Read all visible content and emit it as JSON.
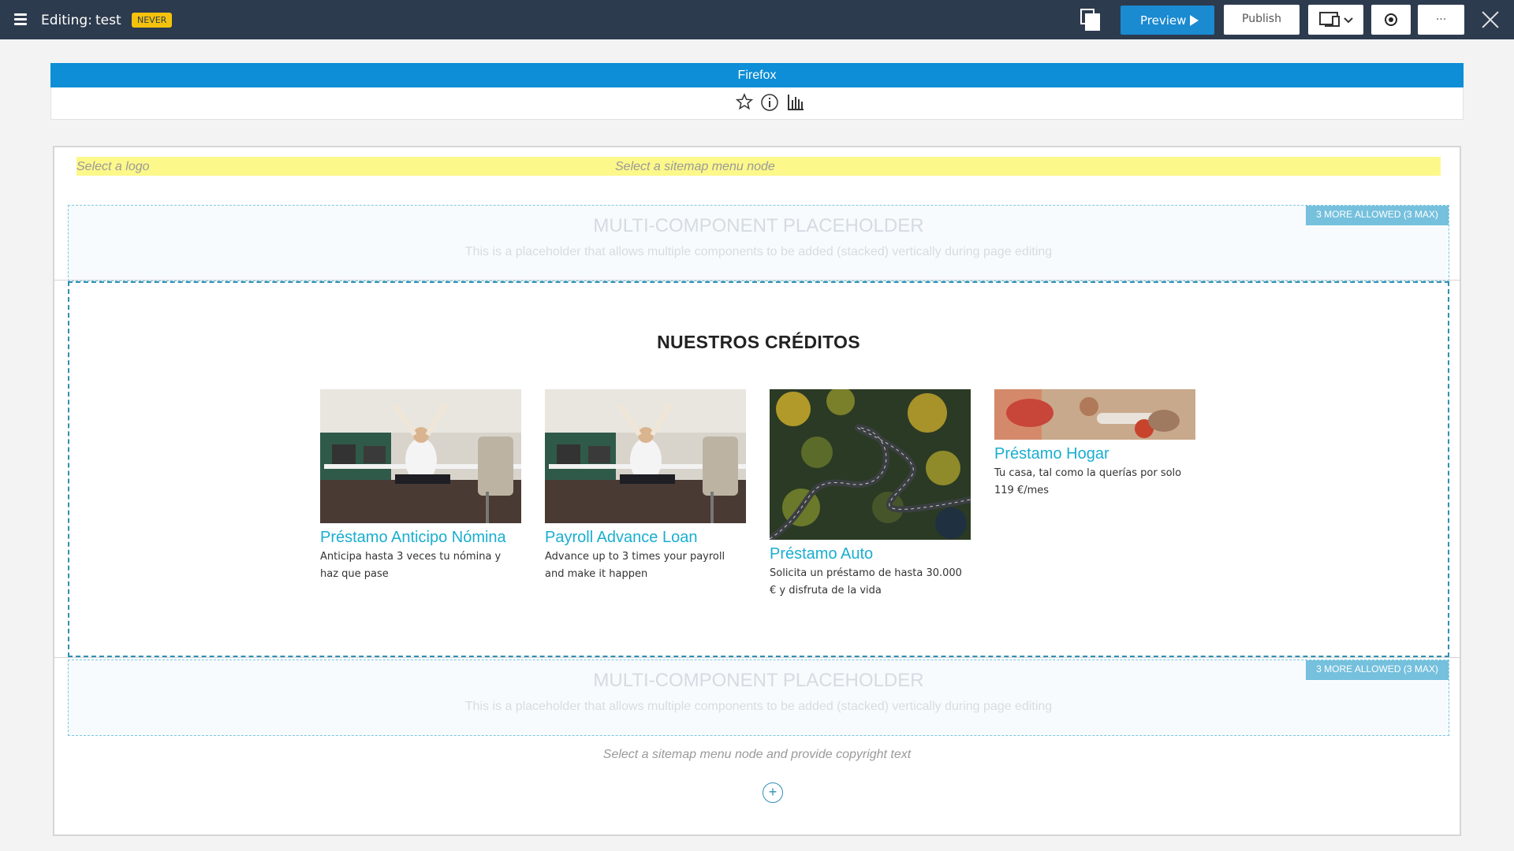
{
  "toolbar": {
    "editing_label": "Editing:",
    "page_name": "test",
    "status_badge": "NEVER",
    "preview_label": "Preview",
    "publish_label": "Publish",
    "more_label": "...",
    "colors": {
      "bar": "#2d3b4e",
      "preview": "#1a8ad1",
      "badge": "#f4c20d"
    }
  },
  "browser": {
    "name": "Firefox",
    "tools": [
      "star-icon",
      "info-icon",
      "bar-chart-icon"
    ]
  },
  "page": {
    "logo_placeholder": "Select a logo",
    "sitemap_placeholder": "Select a sitemap menu node",
    "top_placeholder": {
      "badge": "3 MORE ALLOWED (3 MAX)",
      "title": "MULTI-COMPONENT PLACEHOLDER",
      "description": "This is a placeholder that allows multiple components to be added (stacked) vertically during page editing"
    },
    "credits": {
      "title": "NUESTROS CRÉDITOS",
      "cards": [
        {
          "title": "Préstamo Anticipo Nómina",
          "description": "Anticipa hasta 3 veces tu nómina y haz que pase",
          "image": "office-worker-stretching"
        },
        {
          "title": "Payroll Advance Loan",
          "description": "Advance up to 3 times your payroll and make it happen",
          "image": "office-worker-stretching"
        },
        {
          "title": "Préstamo Auto",
          "description": "Solicita un préstamo de hasta 30.000 € y disfruta de la vida",
          "image": "winding-road-forest-aerial"
        },
        {
          "title": "Préstamo Hogar",
          "description": "Tu casa, tal como la querías por solo 119 €/mes",
          "image": "couple-painting-home"
        }
      ]
    },
    "bottom_placeholder": {
      "badge": "3 MORE ALLOWED (3 MAX)",
      "title": "MULTI-COMPONENT PLACEHOLDER",
      "description": "This is a placeholder that allows multiple components to be added (stacked) vertically during page editing"
    },
    "add_component": "+",
    "footer_placeholder": "Select a sitemap menu node and provide copyright text"
  }
}
